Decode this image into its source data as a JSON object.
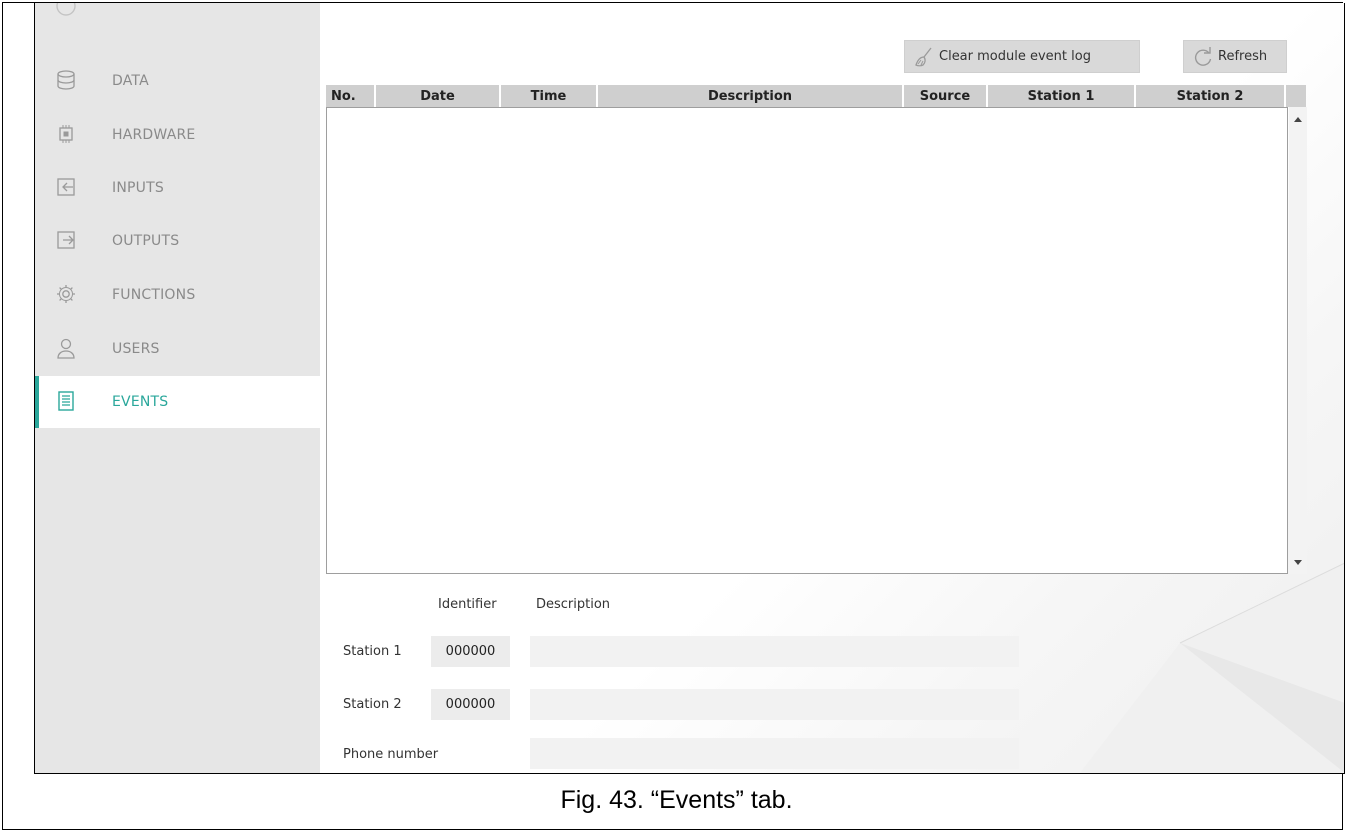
{
  "sidebar": {
    "items": [
      {
        "label": "DATA",
        "icon": "database-icon"
      },
      {
        "label": "HARDWARE",
        "icon": "chip-icon"
      },
      {
        "label": "INPUTS",
        "icon": "input-icon"
      },
      {
        "label": "OUTPUTS",
        "icon": "output-icon"
      },
      {
        "label": "FUNCTIONS",
        "icon": "gear-icon"
      },
      {
        "label": "USERS",
        "icon": "user-icon"
      },
      {
        "label": "EVENTS",
        "icon": "document-icon",
        "active": true
      }
    ],
    "accent_color": "#2aa79b"
  },
  "toolbar": {
    "clear_label": "Clear module event log",
    "refresh_label": "Refresh"
  },
  "table": {
    "columns": [
      "No.",
      "Date",
      "Time",
      "Description",
      "Source",
      "Station 1",
      "Station 2"
    ],
    "rows": []
  },
  "details": {
    "identifier_header": "Identifier",
    "description_header": "Description",
    "station1_label": "Station 1",
    "station1_id": "000000",
    "station2_label": "Station 2",
    "station2_id": "000000",
    "phone_label": "Phone number"
  },
  "caption": "Fig. 43. “Events” tab."
}
